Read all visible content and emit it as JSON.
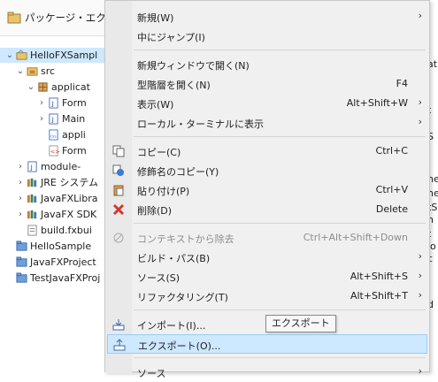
{
  "explorer": {
    "title": "パッケージ・エクスプロ",
    "rows": [
      {
        "label": "HelloFXSampl",
        "twisty": "⌄",
        "icon": "java-project-icon",
        "selected": true
      },
      {
        "label": "src",
        "twisty": "⌄",
        "icon": "source-folder-icon"
      },
      {
        "label": "applicat",
        "twisty": "⌄",
        "icon": "package-icon"
      },
      {
        "label": "Form",
        "twisty": "›",
        "icon": "java-file-icon"
      },
      {
        "label": "Main",
        "twisty": "›",
        "icon": "java-file-icon"
      },
      {
        "label": "appli",
        "twisty": "",
        "icon": "css-file-icon"
      },
      {
        "label": "Form",
        "twisty": "",
        "icon": "fxml-file-icon"
      },
      {
        "label": "module-",
        "twisty": "›",
        "icon": "java-file-icon"
      },
      {
        "label": "JRE システム",
        "twisty": "›",
        "icon": "library-icon"
      },
      {
        "label": "JavaFXLibra",
        "twisty": "›",
        "icon": "library-icon"
      },
      {
        "label": "JavaFX SDK",
        "twisty": "›",
        "icon": "library-icon"
      },
      {
        "label": "build.fxbui",
        "twisty": "",
        "icon": "build-file-icon"
      },
      {
        "label": "HelloSample",
        "twisty": "",
        "icon": "folder-icon"
      },
      {
        "label": "JavaFXProject",
        "twisty": "",
        "icon": "folder-icon"
      },
      {
        "label": "TestJavaFXProj",
        "twisty": "",
        "icon": "folder-icon"
      }
    ]
  },
  "editor_strip": {
    "texts": [
      "at",
      "t",
      "S",
      "he",
      "he",
      "tS",
      "n",
      "t",
      "io",
      "c",
      "d"
    ]
  },
  "menu": {
    "items": [
      {
        "label": "新規(W)",
        "accel": "",
        "submenu": true,
        "icon": "",
        "disabled": false
      },
      {
        "label": "中にジャンプ(I)",
        "accel": "",
        "submenu": false,
        "icon": "",
        "disabled": false
      },
      {
        "sep": true
      },
      {
        "label": "新規ウィンドウで開く(N)",
        "accel": "",
        "submenu": false,
        "icon": "",
        "disabled": false
      },
      {
        "label": "型階層を開く(N)",
        "accel": "F4",
        "submenu": false,
        "icon": "",
        "disabled": false
      },
      {
        "label": "表示(W)",
        "accel": "Alt+Shift+W",
        "submenu": true,
        "icon": "",
        "disabled": false
      },
      {
        "label": "ローカル・ターミナルに表示",
        "accel": "",
        "submenu": true,
        "icon": "",
        "disabled": false
      },
      {
        "sep": true
      },
      {
        "label": "コピー(C)",
        "accel": "Ctrl+C",
        "submenu": false,
        "icon": "copy-icon",
        "disabled": false
      },
      {
        "label": "修飾名のコピー(Y)",
        "accel": "",
        "submenu": false,
        "icon": "copy-qualified-name-icon",
        "disabled": false
      },
      {
        "label": "貼り付け(P)",
        "accel": "Ctrl+V",
        "submenu": false,
        "icon": "paste-icon",
        "disabled": false
      },
      {
        "label": "削除(D)",
        "accel": "Delete",
        "submenu": false,
        "icon": "delete-icon",
        "disabled": false
      },
      {
        "sep": true
      },
      {
        "label": "コンテキストから除去",
        "accel": "Ctrl+Alt+Shift+Down",
        "submenu": false,
        "icon": "remove-context-icon",
        "disabled": true
      },
      {
        "label": "ビルド・パス(B)",
        "accel": "",
        "submenu": true,
        "icon": "",
        "disabled": false
      },
      {
        "label": "ソース(S)",
        "accel": "Alt+Shift+S",
        "submenu": true,
        "icon": "",
        "disabled": false
      },
      {
        "label": "リファクタリング(T)",
        "accel": "Alt+Shift+T",
        "submenu": true,
        "icon": "",
        "disabled": false
      },
      {
        "sep": true
      },
      {
        "label": "インポート(I)...",
        "accel": "",
        "submenu": false,
        "icon": "import-icon",
        "disabled": false
      },
      {
        "label": "エクスポート(O)...",
        "accel": "",
        "submenu": false,
        "icon": "export-icon",
        "disabled": false,
        "hover": true
      },
      {
        "sep": true
      },
      {
        "label": "ソース",
        "accel": "",
        "submenu": true,
        "icon": "",
        "disabled": false
      }
    ]
  },
  "tooltip": {
    "text": "エクスポート"
  },
  "colors": {
    "selection": "#cde8ff",
    "menu_bg": "#f0f0f0",
    "delete_red": "#d9342b"
  }
}
